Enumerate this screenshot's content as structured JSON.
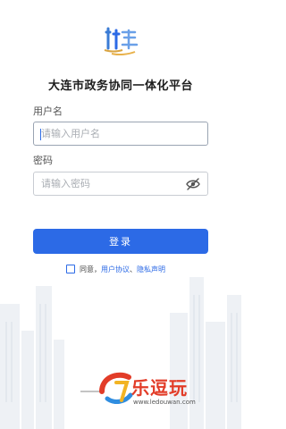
{
  "app": {
    "title": "大连市政务协同一体化平台"
  },
  "form": {
    "username_label": "用户名",
    "username_placeholder": "请输入用户名",
    "username_value": "",
    "password_label": "密码",
    "password_placeholder": "请输入密码",
    "password_value": "",
    "login_label": "登录"
  },
  "agreement": {
    "prefix": "同意，",
    "user_agreement": "用户协议",
    "separator": "、",
    "privacy": "隐私声明",
    "checked": false
  },
  "watermark": {
    "text": "乐逗玩",
    "url": "www.ledouwan.com"
  },
  "colors": {
    "accent": "#2c6ae6",
    "brand_red": "#e23c28"
  },
  "icons": {
    "password_toggle": "eye-slash-icon"
  }
}
